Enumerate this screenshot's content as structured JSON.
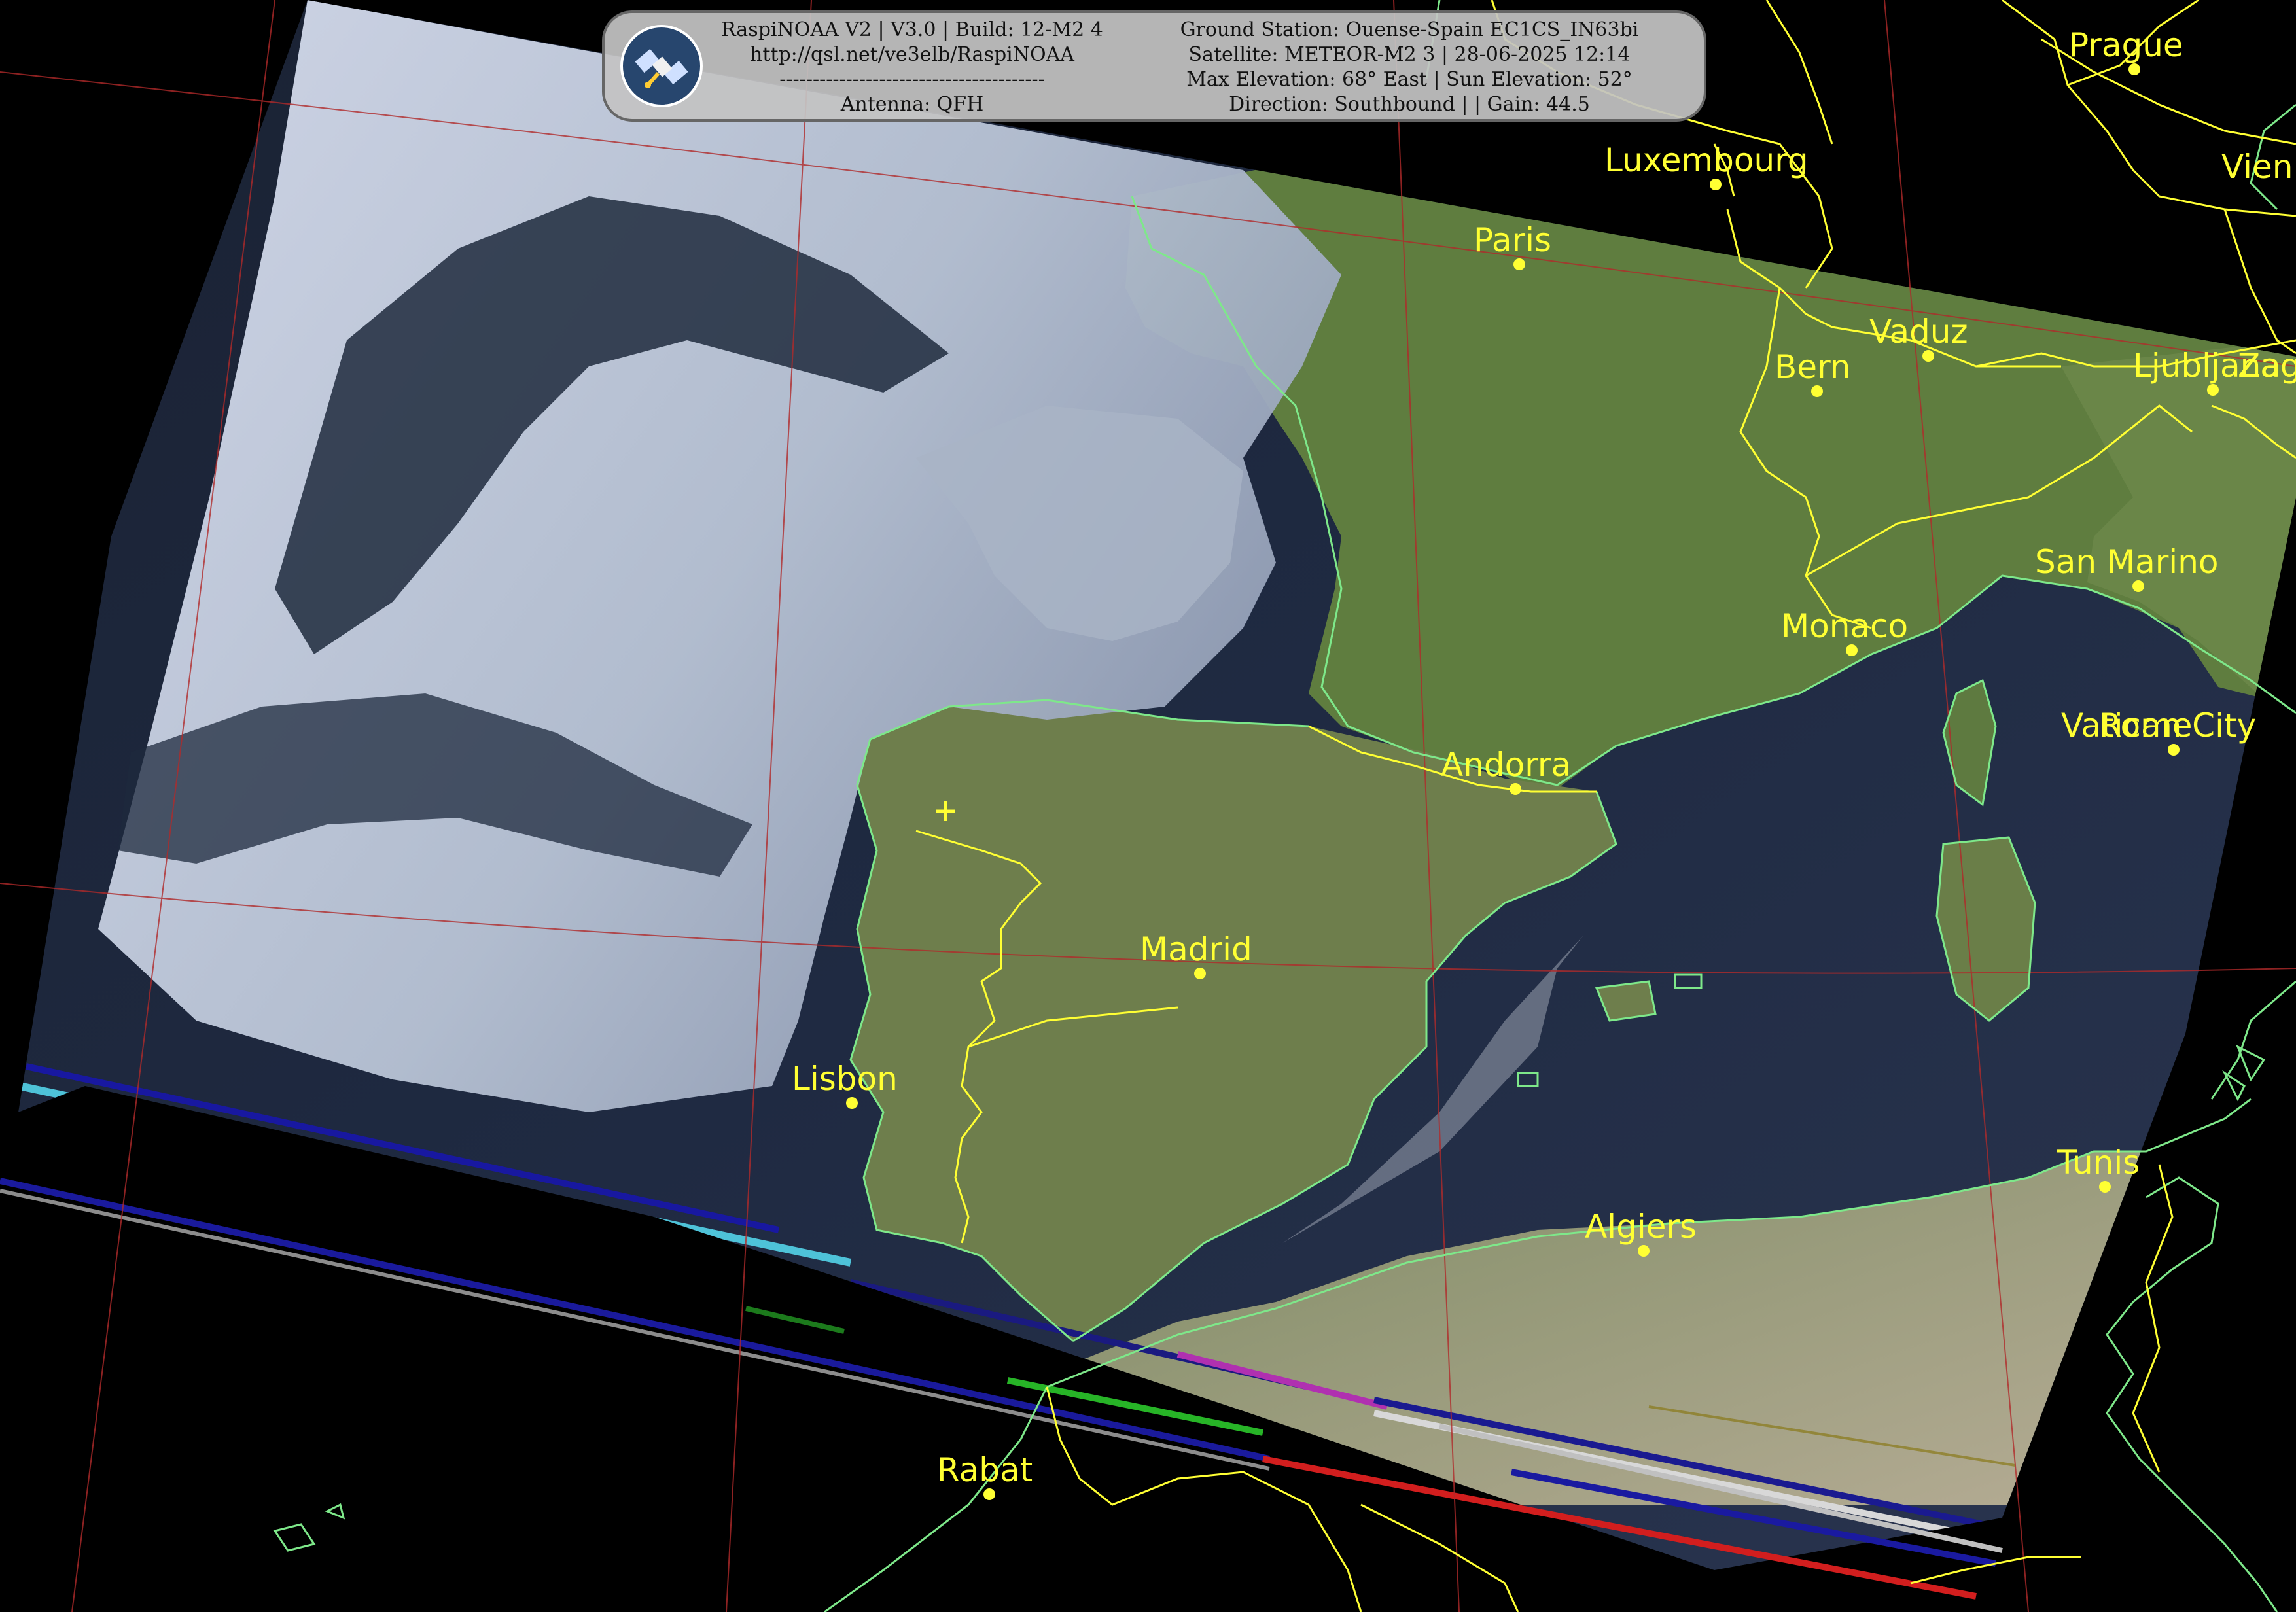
{
  "header": {
    "left_lines": [
      "RaspiNOAA V2 | V3.0 | Build: 12-M2 4",
      "http://qsl.net/ve3elb/RaspiNOAA",
      "----------------------------------------",
      "Antenna: QFH"
    ],
    "right_lines": [
      "Ground Station: Ouense-Spain EC1CS_IN63bi",
      "Satellite: METEOR-M2 3 | 28-06-2025 12:14",
      "Max Elevation: 68° East | Sun Elevation: 52°",
      "Direction: Southbound | | Gain: 44.5"
    ],
    "logo_icon": "satellite-icon"
  },
  "cities": [
    {
      "id": "prague",
      "label": "Prague"
    },
    {
      "id": "luxembourg",
      "label": "Luxembourg"
    },
    {
      "id": "vienna",
      "label": "Vien"
    },
    {
      "id": "paris",
      "label": "Paris"
    },
    {
      "id": "vaduz",
      "label": "Vaduz"
    },
    {
      "id": "bern",
      "label": "Bern"
    },
    {
      "id": "ljubljana",
      "label": "Ljubljana"
    },
    {
      "id": "zagreb",
      "label": "Zag"
    },
    {
      "id": "san-marino",
      "label": "San Marino"
    },
    {
      "id": "monaco",
      "label": "Monaco"
    },
    {
      "id": "vatican-city",
      "label": "Vatican City"
    },
    {
      "id": "rome",
      "label": "Rome"
    },
    {
      "id": "andorra",
      "label": "Andorra"
    },
    {
      "id": "madrid",
      "label": "Madrid"
    },
    {
      "id": "lisbon",
      "label": "Lisbon"
    },
    {
      "id": "tunis",
      "label": "Tunis"
    },
    {
      "id": "algiers",
      "label": "Algiers"
    },
    {
      "id": "rabat",
      "label": "Rabat"
    }
  ],
  "colors": {
    "background": "#000000",
    "city_label": "#ffff33",
    "coastline": "#7ee88a",
    "border": "#ffff33",
    "graticule": "#b02a2a",
    "ocean": "#1b2740",
    "land": "#5a7a3c",
    "cloud": "#cfd9e6"
  },
  "ground_station_marker": "plus-icon"
}
